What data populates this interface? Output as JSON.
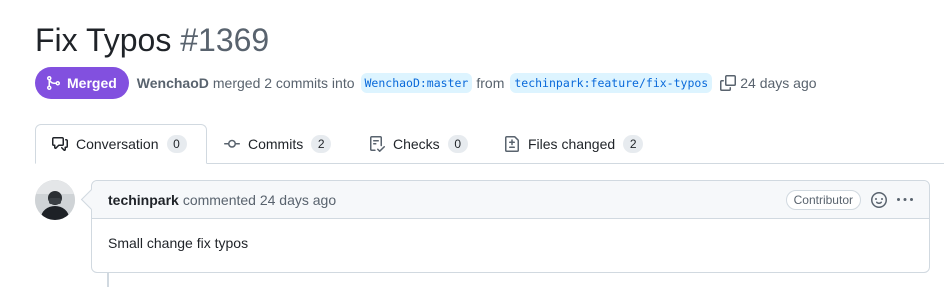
{
  "pr": {
    "title": "Fix Typos",
    "number": "#1369",
    "state": "Merged",
    "author": "WenchaoD",
    "merged_text": "merged 2 commits into",
    "base_branch": "WenchaoD:master",
    "from_text": "from",
    "head_branch": "techinpark:feature/fix-typos",
    "time_ago": "24 days ago"
  },
  "tabs": [
    {
      "label": "Conversation",
      "count": "0",
      "icon": "conversation-icon"
    },
    {
      "label": "Commits",
      "count": "2",
      "icon": "commit-icon"
    },
    {
      "label": "Checks",
      "count": "0",
      "icon": "checklist-icon"
    },
    {
      "label": "Files changed",
      "count": "2",
      "icon": "file-diff-icon"
    }
  ],
  "comment": {
    "author": "techinpark",
    "action": "commented 24 days ago",
    "role": "Contributor",
    "body": "Small change fix typos"
  },
  "colors": {
    "merged": "#8250df",
    "link": "#0969da",
    "branch_bg": "#ddf4ff",
    "border": "#d1d9e0",
    "muted": "#59636e"
  }
}
